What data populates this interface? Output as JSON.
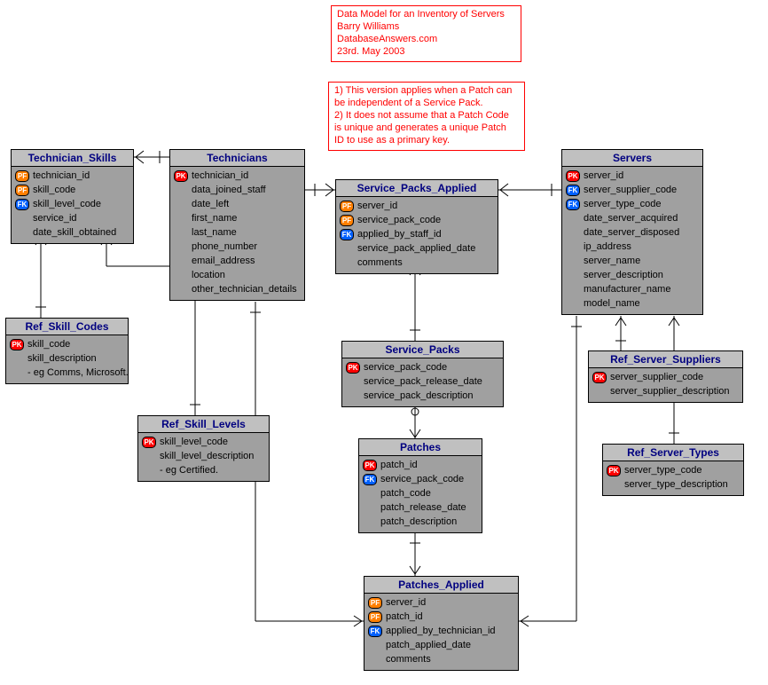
{
  "meta_box": {
    "line1": "Data Model for an Inventory of Servers",
    "line2": "Barry Williams",
    "line3": "DatabaseAnswers.com",
    "line4": "23rd. May 2003"
  },
  "notes_box": {
    "line1": "1) This version applies when a Patch can",
    "line2": "be independent of a Service Pack.",
    "line3": "2) It does not assume that a Patch Code",
    "line4": "is unique and generates a unique Patch",
    "line5": "ID to use as a primary key."
  },
  "entities": {
    "technician_skills": {
      "title": "Technician_Skills",
      "cols": {
        "c0": "technician_id",
        "c1": "skill_code",
        "c2": "skill_level_code",
        "c3": "service_id",
        "c4": "date_skill_obtained"
      }
    },
    "technicians": {
      "title": "Technicians",
      "cols": {
        "c0": "technician_id",
        "c1": "data_joined_staff",
        "c2": "date_left",
        "c3": "first_name",
        "c4": "last_name",
        "c5": "phone_number",
        "c6": "email_address",
        "c7": "location",
        "c8": "other_technician_details"
      }
    },
    "service_packs_applied": {
      "title": "Service_Packs_Applied",
      "cols": {
        "c0": "server_id",
        "c1": "service_pack_code",
        "c2": "applied_by_staff_id",
        "c3": "service_pack_applied_date",
        "c4": "comments"
      }
    },
    "servers": {
      "title": "Servers",
      "cols": {
        "c0": "server_id",
        "c1": "server_supplier_code",
        "c2": "server_type_code",
        "c3": "date_server_acquired",
        "c4": "date_server_disposed",
        "c5": "ip_address",
        "c6": "server_name",
        "c7": "server_description",
        "c8": "manufacturer_name",
        "c9": "model_name"
      }
    },
    "ref_skill_codes": {
      "title": "Ref_Skill_Codes",
      "cols": {
        "c0": "skill_code",
        "c1": "skill_description",
        "c2": "- eg Comms, Microsoft."
      }
    },
    "ref_skill_levels": {
      "title": "Ref_Skill_Levels",
      "cols": {
        "c0": "skill_level_code",
        "c1": "skill_level_description",
        "c2": "- eg Certified."
      }
    },
    "service_packs": {
      "title": "Service_Packs",
      "cols": {
        "c0": "service_pack_code",
        "c1": "service_pack_release_date",
        "c2": "service_pack_description"
      }
    },
    "patches": {
      "title": "Patches",
      "cols": {
        "c0": "patch_id",
        "c1": "service_pack_code",
        "c2": "patch_code",
        "c3": "patch_release_date",
        "c4": "patch_description"
      }
    },
    "patches_applied": {
      "title": "Patches_Applied",
      "cols": {
        "c0": "server_id",
        "c1": "patch_id",
        "c2": "applied_by_technician_id",
        "c3": "patch_applied_date",
        "c4": "comments"
      }
    },
    "ref_server_suppliers": {
      "title": "Ref_Server_Suppliers",
      "cols": {
        "c0": "server_supplier_code",
        "c1": "server_supplier_description"
      }
    },
    "ref_server_types": {
      "title": "Ref_Server_Types",
      "cols": {
        "c0": "server_type_code",
        "c1": "server_type_description"
      }
    }
  },
  "key_labels": {
    "pk": "PK",
    "pf": "PF",
    "fk": "FK"
  }
}
